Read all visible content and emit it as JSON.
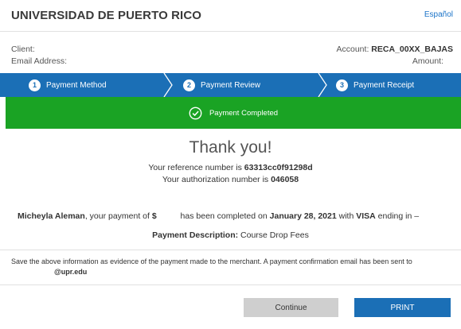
{
  "header": {
    "title": "UNIVERSIDAD DE PUERTO RICO",
    "language_link": "Español"
  },
  "info": {
    "client_label": "Client:",
    "email_label": "Email Address:",
    "account_label": "Account:",
    "account_value": "RECA_00XX_BAJAS",
    "amount_label": "Amount:"
  },
  "steps": [
    {
      "number": "1",
      "label": "Payment Method"
    },
    {
      "number": "2",
      "label": "Payment Review"
    },
    {
      "number": "3",
      "label": "Payment Receipt"
    }
  ],
  "banner": {
    "text": "Payment Completed"
  },
  "receipt": {
    "thanks": "Thank you!",
    "reference_prefix": "Your reference number is",
    "reference_number": "63313cc0f91298d",
    "authorization_prefix": "Your authorization number is",
    "authorization_number": "046058",
    "payer_name": "Micheyla Aleman",
    "pay_text_1": ", your payment of",
    "currency": "$",
    "pay_text_2": "has been completed on",
    "payment_date": "January 28, 2021",
    "pay_text_3": "with",
    "card_brand": "VISA",
    "pay_text_4": "ending in –",
    "description_label": "Payment Description:",
    "description_value": "Course Drop Fees"
  },
  "notice": {
    "text": "Save the above information as evidence of the payment made to the merchant. A payment confirmation email has been sent to",
    "email": "@upr.edu"
  },
  "buttons": {
    "continue": "Continue",
    "print": "PRINT"
  },
  "colors": {
    "primary": "#1b6fb6",
    "success": "#1aa324",
    "button_gray": "#cfcfcf"
  }
}
